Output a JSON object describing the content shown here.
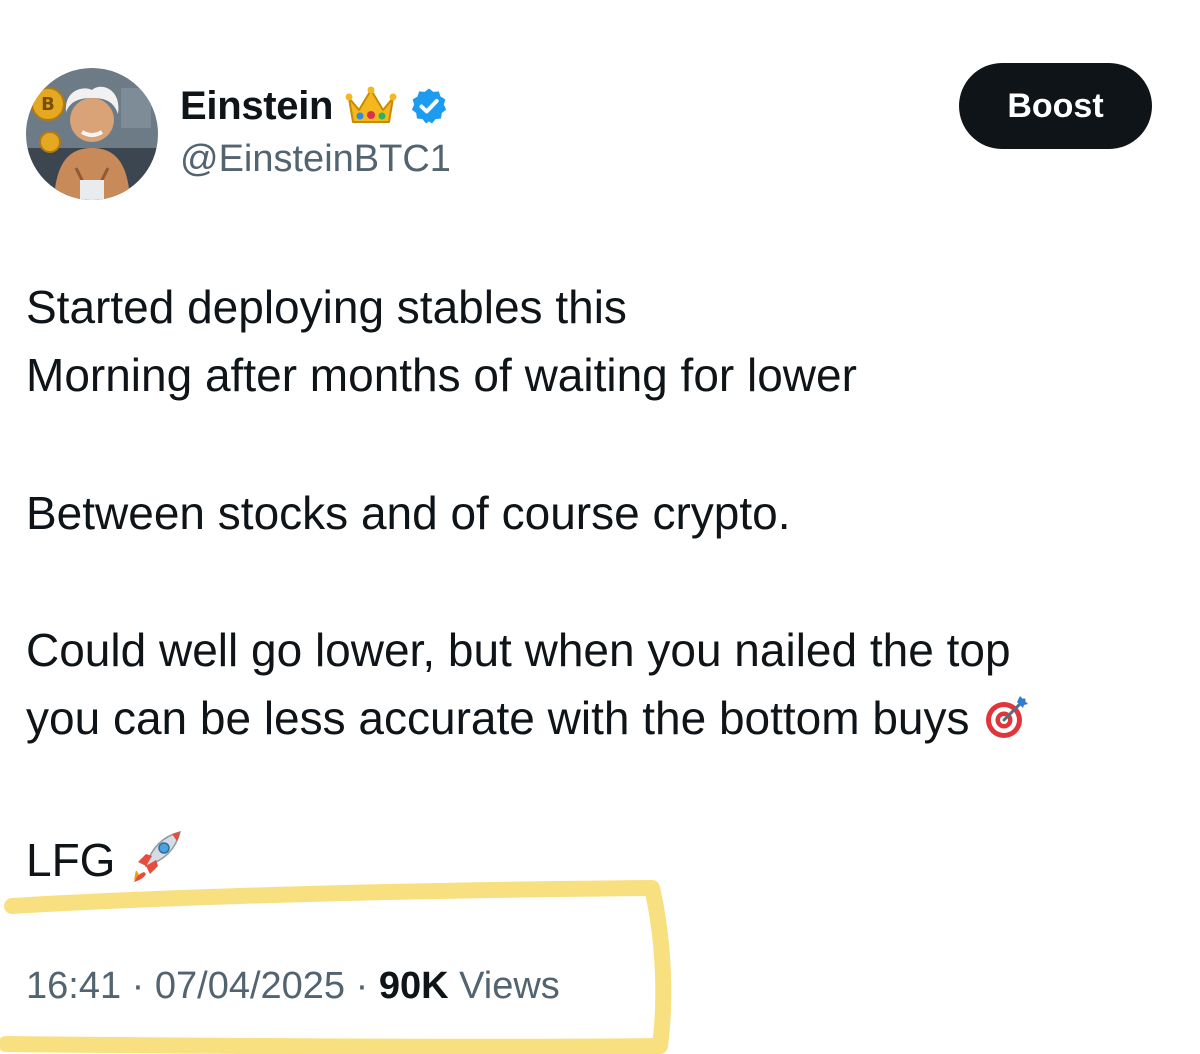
{
  "author": {
    "display_name": "Einstein",
    "handle": "@EinsteinBTC1",
    "avatar_icon": "bitcoin-coin-icon",
    "crown_icon": "crown-icon",
    "verified_icon": "verified-badge-icon",
    "verified_color": "#1d9bf0"
  },
  "boost_label": "Boost",
  "tweet": {
    "lines": [
      "Started deploying stables this",
      "Morning after months of waiting for lower",
      "Between stocks and of course crypto.",
      "Could well go lower, but when you nailed the top",
      "you can be less accurate with the bottom buys",
      "LFG"
    ],
    "target_emoji": "direct-hit-icon",
    "rocket_emoji": "rocket-icon"
  },
  "meta": {
    "time": "16:41",
    "separator": "·",
    "date": "07/04/2025",
    "views_count": "90K",
    "views_label": "Views"
  },
  "annotation": {
    "highlight_color": "#f7d96a"
  }
}
